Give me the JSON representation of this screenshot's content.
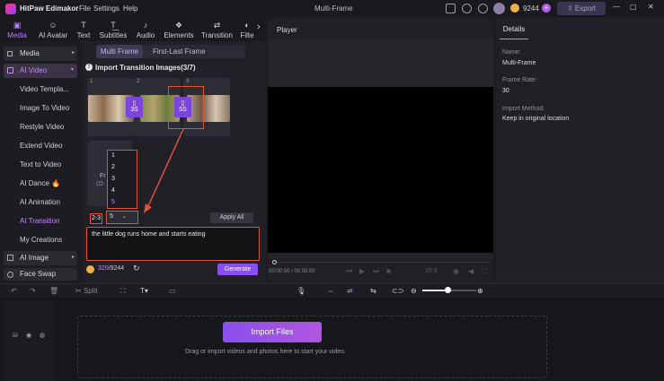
{
  "app": {
    "name": "HitPaw Edimakor",
    "menus": [
      "File",
      "Settings",
      "Help"
    ],
    "window_title": "Multi-Frame",
    "credits_total": "9244",
    "export_label": "Export"
  },
  "toolbar": {
    "tools": [
      "Media",
      "AI Avatar",
      "Text",
      "Subtitles",
      "Audio",
      "Elements",
      "Transition",
      "Filte"
    ]
  },
  "leftnav": {
    "media": "Media",
    "ai_video": "AI Video",
    "items": [
      "Video Templa...",
      "Image To Video",
      "Restyle Video",
      "Extend Video",
      "Text to Video",
      "AI Dance",
      "AI Animation",
      "AI Transition",
      "My Creations"
    ],
    "ai_image": "AI Image",
    "face_swap": "Face Swap"
  },
  "panel": {
    "tab_multi": "Multi Frame",
    "tab_first_last": "First-Last Frame",
    "import_title": "Import Transition Images(3/7)",
    "slots": [
      "1",
      "2",
      "3"
    ],
    "duration_a": "3S",
    "duration_b": "5S",
    "frame_partial": "Fr",
    "frame_partial2": "(O",
    "dropdown_options": [
      "1",
      "2",
      "3",
      "4",
      "5"
    ],
    "range_label": "2-3",
    "range_value": "5",
    "apply_all": "Apply All",
    "prompt": "the little dog runs home and starts eating",
    "credits_used": "320",
    "credits_total": "/9244",
    "generate": "Generate"
  },
  "player": {
    "title": "Player",
    "time": "00:00:00 / 00:00:00",
    "ratio": "16:9"
  },
  "details": {
    "tab": "Details",
    "name_label": "Name:",
    "name_value": "Multi-Frame",
    "fps_label": "Frame Rate:",
    "fps_value": "30",
    "import_label": "Import Method:",
    "import_value": "Keep in original location"
  },
  "bottom": {
    "split": "Split",
    "import_files": "Import Files",
    "drag_hint": "Drag or import videos and photos here to start your video."
  },
  "colors": {
    "accent": "#8a4ff0",
    "highlight": "#e0533a"
  }
}
